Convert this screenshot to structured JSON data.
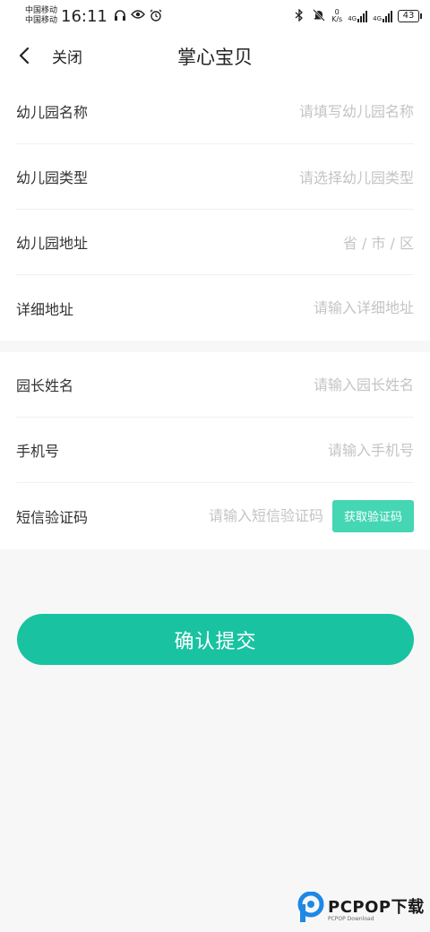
{
  "status_bar": {
    "carrier_1": "中国移动",
    "carrier_2": "中国移动",
    "time": "16:11",
    "net_speed_value": "0",
    "net_speed_unit": "K/s",
    "net_type_1": "4G",
    "net_type_2": "4G",
    "battery": "43"
  },
  "nav": {
    "close_label": "关闭",
    "title": "掌心宝贝"
  },
  "form_1": [
    {
      "label": "幼儿园名称",
      "placeholder": "请填写幼儿园名称"
    },
    {
      "label": "幼儿园类型",
      "placeholder": "请选择幼儿园类型"
    },
    {
      "label": "幼儿园地址",
      "placeholder": "省 / 市 / 区"
    },
    {
      "label": "详细地址",
      "placeholder": "请输入详细地址"
    }
  ],
  "form_2": [
    {
      "label": "园长姓名",
      "placeholder": "请输入园长姓名"
    },
    {
      "label": "手机号",
      "placeholder": "请输入手机号"
    },
    {
      "label": "短信验证码",
      "placeholder": "请输入短信验证码"
    }
  ],
  "get_code_label": "获取验证码",
  "submit_label": "确认提交",
  "watermark": {
    "main": "PCPOP下载",
    "sub": "PCPOP Download"
  },
  "colors": {
    "primary": "#19c3a2",
    "code_button": "#45d6b4",
    "placeholder": "#c4c4c4"
  }
}
